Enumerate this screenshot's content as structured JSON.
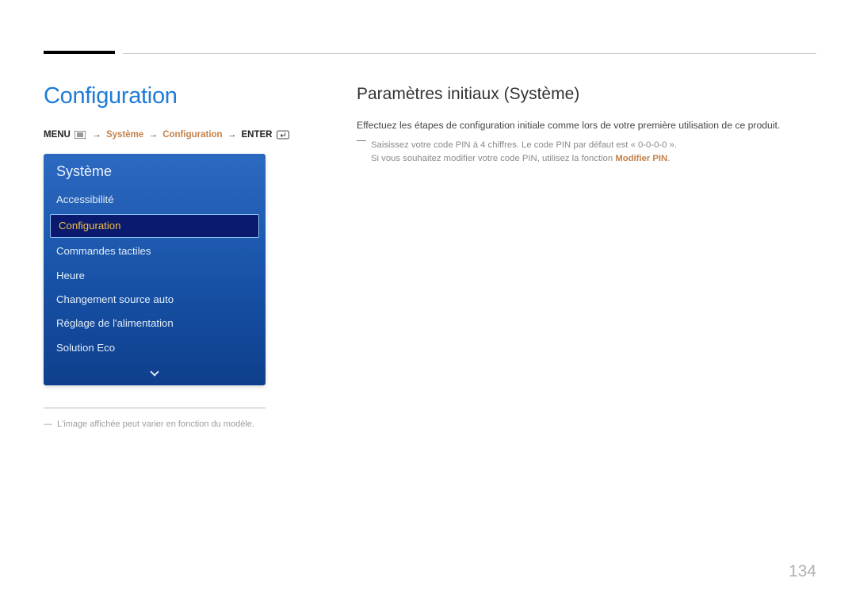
{
  "page_title": "Configuration",
  "breadcrumb": {
    "menu_label": "MENU",
    "systeme": "Système",
    "config": "Configuration",
    "enter_label": "ENTER"
  },
  "osd": {
    "title": "Système",
    "items": [
      {
        "label": "Accessibilité",
        "selected": false
      },
      {
        "label": "Configuration",
        "selected": true
      },
      {
        "label": "Commandes tactiles",
        "selected": false
      },
      {
        "label": "Heure",
        "selected": false
      },
      {
        "label": "Changement source auto",
        "selected": false
      },
      {
        "label": "Réglage de l'alimentation",
        "selected": false
      },
      {
        "label": "Solution Eco",
        "selected": false
      }
    ]
  },
  "left_footnote": "L'image affichée peut varier en fonction du modèle.",
  "right": {
    "heading": "Paramètres initiaux (Système)",
    "body": "Effectuez les étapes de configuration initiale comme lors de votre première utilisation de ce produit.",
    "note_line1": "Saisissez votre code PIN à 4 chiffres. Le code PIN par défaut est « 0-0-0-0 ».",
    "note_line2_prefix": "Si vous souhaitez modifier votre code PIN, utilisez la fonction ",
    "note_line2_accent": "Modifier PIN",
    "note_line2_suffix": "."
  },
  "page_number": "134"
}
